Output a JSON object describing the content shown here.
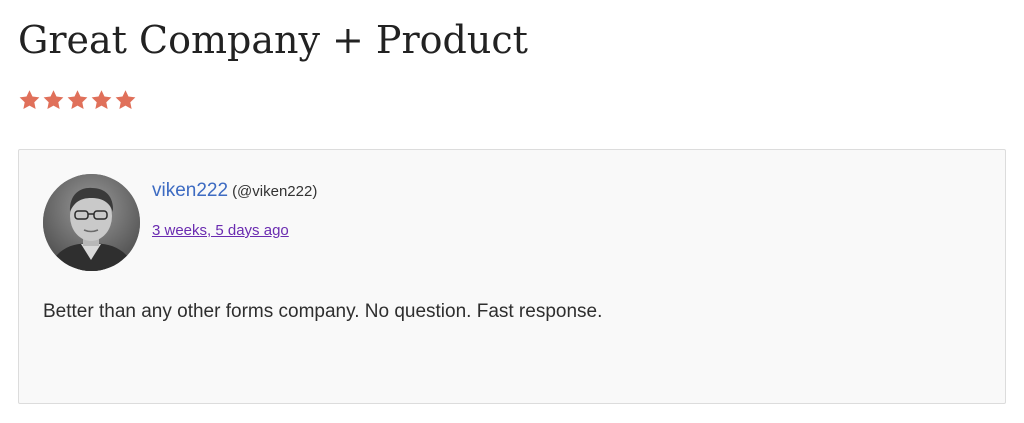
{
  "review": {
    "title": "Great Company + Product",
    "rating": {
      "value": 5,
      "max": 5,
      "star_color": "#E0705A"
    },
    "author": {
      "name": "viken222",
      "handle": "(@viken222)",
      "name_color": "#3D6BC2"
    },
    "date": "3 weeks, 5 days ago",
    "date_color": "#6A2BB0",
    "body": "Better than any other forms company. No question. Fast response."
  }
}
